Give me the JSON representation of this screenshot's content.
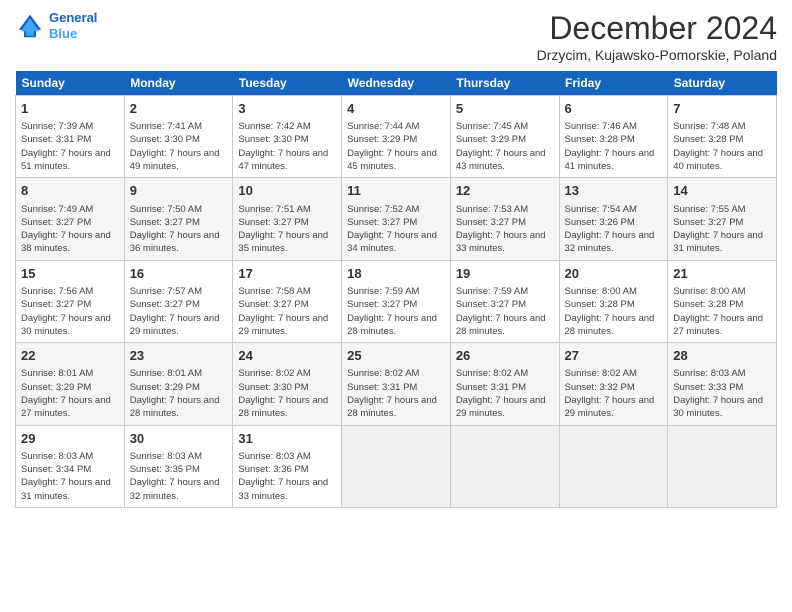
{
  "header": {
    "logo_line1": "General",
    "logo_line2": "Blue",
    "month": "December 2024",
    "location": "Drzycim, Kujawsko-Pomorskie, Poland"
  },
  "days_of_week": [
    "Sunday",
    "Monday",
    "Tuesday",
    "Wednesday",
    "Thursday",
    "Friday",
    "Saturday"
  ],
  "weeks": [
    [
      {
        "day": "1",
        "sunrise": "Sunrise: 7:39 AM",
        "sunset": "Sunset: 3:31 PM",
        "daylight": "Daylight: 7 hours and 51 minutes."
      },
      {
        "day": "2",
        "sunrise": "Sunrise: 7:41 AM",
        "sunset": "Sunset: 3:30 PM",
        "daylight": "Daylight: 7 hours and 49 minutes."
      },
      {
        "day": "3",
        "sunrise": "Sunrise: 7:42 AM",
        "sunset": "Sunset: 3:30 PM",
        "daylight": "Daylight: 7 hours and 47 minutes."
      },
      {
        "day": "4",
        "sunrise": "Sunrise: 7:44 AM",
        "sunset": "Sunset: 3:29 PM",
        "daylight": "Daylight: 7 hours and 45 minutes."
      },
      {
        "day": "5",
        "sunrise": "Sunrise: 7:45 AM",
        "sunset": "Sunset: 3:29 PM",
        "daylight": "Daylight: 7 hours and 43 minutes."
      },
      {
        "day": "6",
        "sunrise": "Sunrise: 7:46 AM",
        "sunset": "Sunset: 3:28 PM",
        "daylight": "Daylight: 7 hours and 41 minutes."
      },
      {
        "day": "7",
        "sunrise": "Sunrise: 7:48 AM",
        "sunset": "Sunset: 3:28 PM",
        "daylight": "Daylight: 7 hours and 40 minutes."
      }
    ],
    [
      {
        "day": "8",
        "sunrise": "Sunrise: 7:49 AM",
        "sunset": "Sunset: 3:27 PM",
        "daylight": "Daylight: 7 hours and 38 minutes."
      },
      {
        "day": "9",
        "sunrise": "Sunrise: 7:50 AM",
        "sunset": "Sunset: 3:27 PM",
        "daylight": "Daylight: 7 hours and 36 minutes."
      },
      {
        "day": "10",
        "sunrise": "Sunrise: 7:51 AM",
        "sunset": "Sunset: 3:27 PM",
        "daylight": "Daylight: 7 hours and 35 minutes."
      },
      {
        "day": "11",
        "sunrise": "Sunrise: 7:52 AM",
        "sunset": "Sunset: 3:27 PM",
        "daylight": "Daylight: 7 hours and 34 minutes."
      },
      {
        "day": "12",
        "sunrise": "Sunrise: 7:53 AM",
        "sunset": "Sunset: 3:27 PM",
        "daylight": "Daylight: 7 hours and 33 minutes."
      },
      {
        "day": "13",
        "sunrise": "Sunrise: 7:54 AM",
        "sunset": "Sunset: 3:26 PM",
        "daylight": "Daylight: 7 hours and 32 minutes."
      },
      {
        "day": "14",
        "sunrise": "Sunrise: 7:55 AM",
        "sunset": "Sunset: 3:27 PM",
        "daylight": "Daylight: 7 hours and 31 minutes."
      }
    ],
    [
      {
        "day": "15",
        "sunrise": "Sunrise: 7:56 AM",
        "sunset": "Sunset: 3:27 PM",
        "daylight": "Daylight: 7 hours and 30 minutes."
      },
      {
        "day": "16",
        "sunrise": "Sunrise: 7:57 AM",
        "sunset": "Sunset: 3:27 PM",
        "daylight": "Daylight: 7 hours and 29 minutes."
      },
      {
        "day": "17",
        "sunrise": "Sunrise: 7:58 AM",
        "sunset": "Sunset: 3:27 PM",
        "daylight": "Daylight: 7 hours and 29 minutes."
      },
      {
        "day": "18",
        "sunrise": "Sunrise: 7:59 AM",
        "sunset": "Sunset: 3:27 PM",
        "daylight": "Daylight: 7 hours and 28 minutes."
      },
      {
        "day": "19",
        "sunrise": "Sunrise: 7:59 AM",
        "sunset": "Sunset: 3:27 PM",
        "daylight": "Daylight: 7 hours and 28 minutes."
      },
      {
        "day": "20",
        "sunrise": "Sunrise: 8:00 AM",
        "sunset": "Sunset: 3:28 PM",
        "daylight": "Daylight: 7 hours and 28 minutes."
      },
      {
        "day": "21",
        "sunrise": "Sunrise: 8:00 AM",
        "sunset": "Sunset: 3:28 PM",
        "daylight": "Daylight: 7 hours and 27 minutes."
      }
    ],
    [
      {
        "day": "22",
        "sunrise": "Sunrise: 8:01 AM",
        "sunset": "Sunset: 3:29 PM",
        "daylight": "Daylight: 7 hours and 27 minutes."
      },
      {
        "day": "23",
        "sunrise": "Sunrise: 8:01 AM",
        "sunset": "Sunset: 3:29 PM",
        "daylight": "Daylight: 7 hours and 28 minutes."
      },
      {
        "day": "24",
        "sunrise": "Sunrise: 8:02 AM",
        "sunset": "Sunset: 3:30 PM",
        "daylight": "Daylight: 7 hours and 28 minutes."
      },
      {
        "day": "25",
        "sunrise": "Sunrise: 8:02 AM",
        "sunset": "Sunset: 3:31 PM",
        "daylight": "Daylight: 7 hours and 28 minutes."
      },
      {
        "day": "26",
        "sunrise": "Sunrise: 8:02 AM",
        "sunset": "Sunset: 3:31 PM",
        "daylight": "Daylight: 7 hours and 29 minutes."
      },
      {
        "day": "27",
        "sunrise": "Sunrise: 8:02 AM",
        "sunset": "Sunset: 3:32 PM",
        "daylight": "Daylight: 7 hours and 29 minutes."
      },
      {
        "day": "28",
        "sunrise": "Sunrise: 8:03 AM",
        "sunset": "Sunset: 3:33 PM",
        "daylight": "Daylight: 7 hours and 30 minutes."
      }
    ],
    [
      {
        "day": "29",
        "sunrise": "Sunrise: 8:03 AM",
        "sunset": "Sunset: 3:34 PM",
        "daylight": "Daylight: 7 hours and 31 minutes."
      },
      {
        "day": "30",
        "sunrise": "Sunrise: 8:03 AM",
        "sunset": "Sunset: 3:35 PM",
        "daylight": "Daylight: 7 hours and 32 minutes."
      },
      {
        "day": "31",
        "sunrise": "Sunrise: 8:03 AM",
        "sunset": "Sunset: 3:36 PM",
        "daylight": "Daylight: 7 hours and 33 minutes."
      },
      {
        "day": "",
        "sunrise": "",
        "sunset": "",
        "daylight": ""
      },
      {
        "day": "",
        "sunrise": "",
        "sunset": "",
        "daylight": ""
      },
      {
        "day": "",
        "sunrise": "",
        "sunset": "",
        "daylight": ""
      },
      {
        "day": "",
        "sunrise": "",
        "sunset": "",
        "daylight": ""
      }
    ]
  ]
}
